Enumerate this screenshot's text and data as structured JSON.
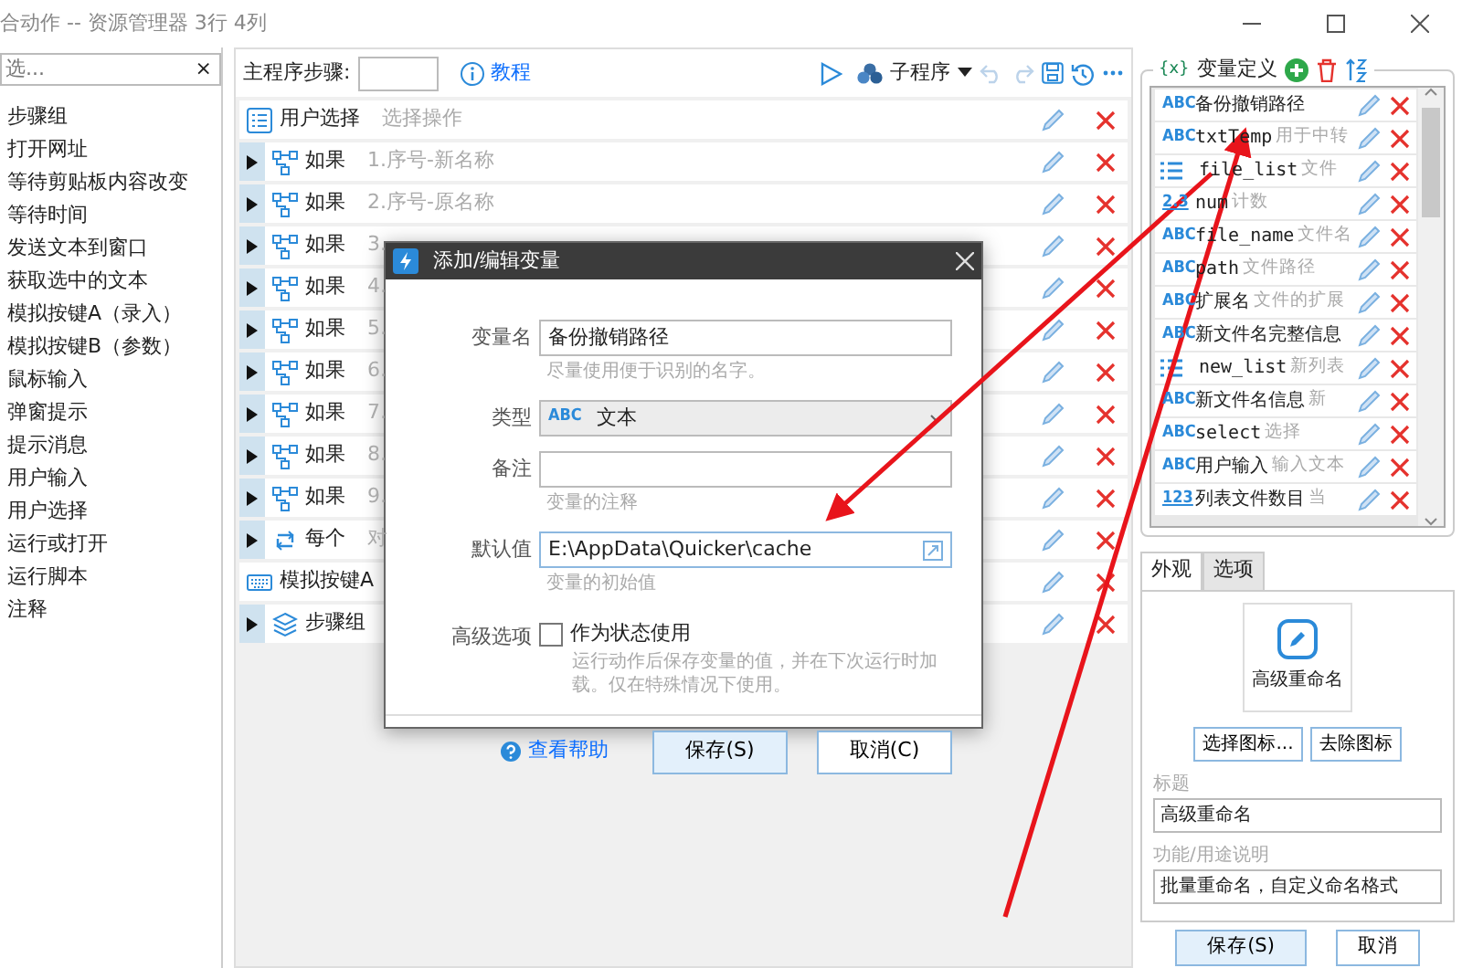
{
  "window": {
    "title": "合动作 -- 资源管理器 3行 4列"
  },
  "sidebar": {
    "search_placeholder": "选...",
    "clear": "×",
    "items": [
      "步骤组",
      "打开网址",
      "等待剪贴板内容改变",
      "等待时间",
      "发送文本到窗口",
      "获取选中的文本",
      "模拟按键A（录入）",
      "模拟按键B（参数）",
      "鼠标输入",
      "弹窗提示",
      "提示消息",
      "用户输入",
      "用户选择",
      "运行或打开",
      "运行脚本",
      "注释"
    ]
  },
  "toolbar": {
    "steps_label": "主程序步骤:",
    "tutorial": "教程",
    "subprogram": "子程序"
  },
  "steps": [
    {
      "kind": "list",
      "expandable": false,
      "title": "用户选择",
      "desc": "选择操作"
    },
    {
      "kind": "branch",
      "expandable": true,
      "title": "如果",
      "desc": "1.序号-新名称"
    },
    {
      "kind": "branch",
      "expandable": true,
      "title": "如果",
      "desc": "2.序号-原名称"
    },
    {
      "kind": "branch",
      "expandable": true,
      "title": "如果",
      "desc": "3."
    },
    {
      "kind": "branch",
      "expandable": true,
      "title": "如果",
      "desc": "4."
    },
    {
      "kind": "branch",
      "expandable": true,
      "title": "如果",
      "desc": "5."
    },
    {
      "kind": "branch",
      "expandable": true,
      "title": "如果",
      "desc": "6."
    },
    {
      "kind": "branch",
      "expandable": true,
      "title": "如果",
      "desc": "7."
    },
    {
      "kind": "branch",
      "expandable": true,
      "title": "如果",
      "desc": "8."
    },
    {
      "kind": "branch",
      "expandable": true,
      "title": "如果",
      "desc": "9."
    },
    {
      "kind": "loop",
      "expandable": true,
      "title": "每个",
      "desc": "对"
    },
    {
      "kind": "keyboard",
      "expandable": false,
      "title": "模拟按键A"
    },
    {
      "kind": "layers",
      "expandable": true,
      "title": "步骤组"
    }
  ],
  "variables": {
    "title": "变量定义",
    "title_icon": "{x}",
    "rows": [
      {
        "kind": "text",
        "icon_text": "ABC",
        "name": "备份撤销路径"
      },
      {
        "kind": "text",
        "icon_text": "ABC",
        "name": "txtTemp",
        "desc": "用于中转"
      },
      {
        "kind": "list",
        "icon_text": "",
        "name": "file_list",
        "desc": "文件"
      },
      {
        "kind": "number",
        "icon_text": "2.3",
        "name": "num",
        "desc": "计数"
      },
      {
        "kind": "text",
        "icon_text": "ABC",
        "name": "file_name",
        "desc": "文件名"
      },
      {
        "kind": "text",
        "icon_text": "ABC",
        "name": "path",
        "desc": "文件路径"
      },
      {
        "kind": "text",
        "icon_text": "ABC",
        "name": "扩展名",
        "desc": "文件的扩展"
      },
      {
        "kind": "text",
        "icon_text": "ABC",
        "name": "新文件名完整信息"
      },
      {
        "kind": "list",
        "icon_text": "",
        "name": "new_list",
        "desc": "新列表"
      },
      {
        "kind": "text",
        "icon_text": "ABC",
        "name": "新文件名信息",
        "desc": "新"
      },
      {
        "kind": "text",
        "icon_text": "ABC",
        "name": "select",
        "desc": "选择"
      },
      {
        "kind": "text",
        "icon_text": "ABC",
        "name": "用户输入",
        "desc": "输入文本"
      },
      {
        "kind": "number",
        "icon_text": "123",
        "name": "列表文件数目",
        "desc": "当"
      }
    ]
  },
  "appearance": {
    "tabs": [
      {
        "label": "外观",
        "selected": true
      },
      {
        "label": "选项",
        "selected": false
      }
    ],
    "icon_caption": "高级重命名",
    "choose_icon": "选择图标...",
    "remove_icon": "去除图标",
    "title_label": "标题",
    "title_value": "高级重命名",
    "desc_label": "功能/用途说明",
    "desc_value": "批量重命名，自定义命名格式"
  },
  "footer_buttons": [
    "保存(S)",
    "取消"
  ],
  "dialog": {
    "title": "添加/编辑变量",
    "fields": [
      {
        "kind": "input",
        "label": "变量名",
        "value": "备份撤销路径",
        "hint": "尽量使用便于识别的名字。"
      },
      {
        "kind": "select",
        "label": "类型",
        "type_icon": "ABC",
        "value": "文本"
      },
      {
        "kind": "input",
        "label": "备注",
        "hint": "变量的注释"
      },
      {
        "kind": "expand",
        "label": "默认值",
        "value": "E:\\AppData\\Quicker\\cache",
        "hint": "变量的初始值"
      }
    ],
    "advanced": {
      "label": "高级选项",
      "checkbox_label": "作为状态使用",
      "checked": false,
      "hint": "运行动作后保存变量的值，并在下次运行时加载。仅在特殊情况下使用。"
    },
    "help": "查看帮助",
    "buttons": [
      "保存(S)",
      "取消(C)"
    ]
  }
}
